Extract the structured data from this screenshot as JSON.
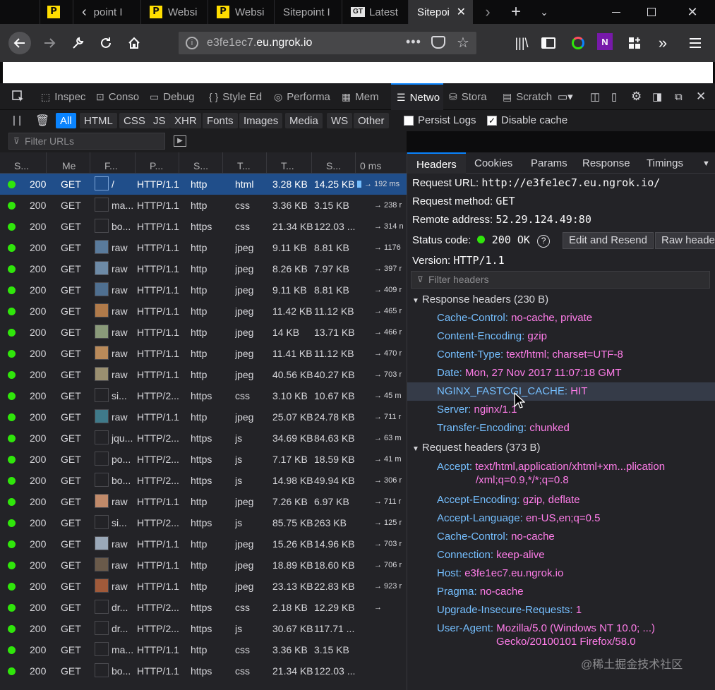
{
  "tabs": [
    {
      "label": "",
      "icon": "sitepoint-logo"
    },
    {
      "label": "point I",
      "icon": "sitepoint-logo"
    },
    {
      "label": "Websi",
      "icon": "sitepoint-logo"
    },
    {
      "label": "Websi",
      "icon": "sitepoint-logo"
    },
    {
      "label": "Sitepoint I",
      "icon": ""
    },
    {
      "label": "Latest",
      "icon": "gt-logo"
    },
    {
      "label": "Sitepoi",
      "icon": ""
    }
  ],
  "nav": {
    "url_host_prefix": "e3fe1ec7.",
    "url_host_main": "eu.ngrok.io"
  },
  "devtools": {
    "tabs": [
      {
        "label": "Inspec"
      },
      {
        "label": "Conso"
      },
      {
        "label": "Debug"
      },
      {
        "label": "Style Ed"
      },
      {
        "label": "Performa"
      },
      {
        "label": "Mem"
      },
      {
        "label": "Netwo"
      },
      {
        "label": "Stora"
      },
      {
        "label": "Scratch"
      }
    ]
  },
  "filters": {
    "types": [
      "All",
      "HTML",
      "CSS",
      "JS",
      "XHR",
      "Fonts",
      "Images",
      "Media",
      "WS",
      "Other"
    ],
    "persist_logs": "Persist Logs",
    "disable_cache": "Disable cache",
    "url_placeholder": "Filter URLs"
  },
  "columns": [
    "S...",
    "Me",
    "F...",
    "P...",
    "S...",
    "T...",
    "T...",
    "S...",
    "0 ms"
  ],
  "requests": [
    {
      "status": "200",
      "method": "GET",
      "file": "/",
      "proto": "HTTP/1.1",
      "scheme": "http",
      "type": "html",
      "transferred": "3.28 KB",
      "size": "14.25 KB",
      "time": "→ 192 ms",
      "thumb": "",
      "sel": true
    },
    {
      "status": "200",
      "method": "GET",
      "file": "ma...",
      "proto": "HTTP/1.1",
      "scheme": "http",
      "type": "css",
      "transferred": "3.36 KB",
      "size": "3.15 KB",
      "time": "→ 238 r",
      "thumb": ""
    },
    {
      "status": "200",
      "method": "GET",
      "file": "bo...",
      "proto": "HTTP/1.1",
      "scheme": "https",
      "type": "css",
      "transferred": "21.34 KB",
      "size": "122.03 ...",
      "time": "→ 314 n",
      "thumb": ""
    },
    {
      "status": "200",
      "method": "GET",
      "file": "raw",
      "proto": "HTTP/1.1",
      "scheme": "http",
      "type": "jpeg",
      "transferred": "9.11 KB",
      "size": "8.81 KB",
      "time": "→ 1176",
      "thumb": "#5a7b9c"
    },
    {
      "status": "200",
      "method": "GET",
      "file": "raw",
      "proto": "HTTP/1.1",
      "scheme": "http",
      "type": "jpeg",
      "transferred": "8.26 KB",
      "size": "7.97 KB",
      "time": "→ 397 r",
      "thumb": "#6d8aa6"
    },
    {
      "status": "200",
      "method": "GET",
      "file": "raw",
      "proto": "HTTP/1.1",
      "scheme": "http",
      "type": "jpeg",
      "transferred": "9.11 KB",
      "size": "8.81 KB",
      "time": "→ 409 r",
      "thumb": "#4f6f90"
    },
    {
      "status": "200",
      "method": "GET",
      "file": "raw",
      "proto": "HTTP/1.1",
      "scheme": "http",
      "type": "jpeg",
      "transferred": "11.42 KB",
      "size": "11.12 KB",
      "time": "→ 465 r",
      "thumb": "#b07a4a"
    },
    {
      "status": "200",
      "method": "GET",
      "file": "raw",
      "proto": "HTTP/1.1",
      "scheme": "http",
      "type": "jpeg",
      "transferred": "14 KB",
      "size": "13.71 KB",
      "time": "→ 466 r",
      "thumb": "#8a9a7a"
    },
    {
      "status": "200",
      "method": "GET",
      "file": "raw",
      "proto": "HTTP/1.1",
      "scheme": "http",
      "type": "jpeg",
      "transferred": "11.41 KB",
      "size": "11.12 KB",
      "time": "→ 470 r",
      "thumb": "#b98a5a"
    },
    {
      "status": "200",
      "method": "GET",
      "file": "raw",
      "proto": "HTTP/1.1",
      "scheme": "http",
      "type": "jpeg",
      "transferred": "40.56 KB",
      "size": "40.27 KB",
      "time": "→ 703 r",
      "thumb": "#9a8f70"
    },
    {
      "status": "200",
      "method": "GET",
      "file": "si...",
      "proto": "HTTP/2...",
      "scheme": "https",
      "type": "css",
      "transferred": "3.10 KB",
      "size": "10.67 KB",
      "time": "→ 45 m",
      "thumb": ""
    },
    {
      "status": "200",
      "method": "GET",
      "file": "raw",
      "proto": "HTTP/1.1",
      "scheme": "http",
      "type": "jpeg",
      "transferred": "25.07 KB",
      "size": "24.78 KB",
      "time": "→ 711 r",
      "thumb": "#3f7a8a"
    },
    {
      "status": "200",
      "method": "GET",
      "file": "jqu...",
      "proto": "HTTP/2...",
      "scheme": "https",
      "type": "js",
      "transferred": "34.69 KB",
      "size": "84.63 KB",
      "time": "→ 63 m",
      "thumb": ""
    },
    {
      "status": "200",
      "method": "GET",
      "file": "po...",
      "proto": "HTTP/2...",
      "scheme": "https",
      "type": "js",
      "transferred": "7.17 KB",
      "size": "18.59 KB",
      "time": "→ 41 m",
      "thumb": ""
    },
    {
      "status": "200",
      "method": "GET",
      "file": "bo...",
      "proto": "HTTP/2...",
      "scheme": "https",
      "type": "js",
      "transferred": "14.98 KB",
      "size": "49.94 KB",
      "time": "→ 306 r",
      "thumb": ""
    },
    {
      "status": "200",
      "method": "GET",
      "file": "raw",
      "proto": "HTTP/1.1",
      "scheme": "http",
      "type": "jpeg",
      "transferred": "7.26 KB",
      "size": "6.97 KB",
      "time": "→ 711 r",
      "thumb": "#c08a6a"
    },
    {
      "status": "200",
      "method": "GET",
      "file": "si...",
      "proto": "HTTP/2...",
      "scheme": "https",
      "type": "js",
      "transferred": "85.75 KB",
      "size": "263 KB",
      "time": "→ 125 r",
      "thumb": ""
    },
    {
      "status": "200",
      "method": "GET",
      "file": "raw",
      "proto": "HTTP/1.1",
      "scheme": "http",
      "type": "jpeg",
      "transferred": "15.26 KB",
      "size": "14.96 KB",
      "time": "→ 703 r",
      "thumb": "#9aa8b8"
    },
    {
      "status": "200",
      "method": "GET",
      "file": "raw",
      "proto": "HTTP/1.1",
      "scheme": "http",
      "type": "jpeg",
      "transferred": "18.89 KB",
      "size": "18.60 KB",
      "time": "→ 706 r",
      "thumb": "#6a5a4a"
    },
    {
      "status": "200",
      "method": "GET",
      "file": "raw",
      "proto": "HTTP/1.1",
      "scheme": "http",
      "type": "jpeg",
      "transferred": "23.13 KB",
      "size": "22.83 KB",
      "time": "→ 923 r",
      "thumb": "#a05a3a"
    },
    {
      "status": "200",
      "method": "GET",
      "file": "dr...",
      "proto": "HTTP/2...",
      "scheme": "https",
      "type": "css",
      "transferred": "2.18 KB",
      "size": "12.29 KB",
      "time": "→",
      "thumb": ""
    },
    {
      "status": "200",
      "method": "GET",
      "file": "dr...",
      "proto": "HTTP/2...",
      "scheme": "https",
      "type": "js",
      "transferred": "30.67 KB",
      "size": "117.71 ...",
      "time": "",
      "thumb": ""
    },
    {
      "status": "200",
      "method": "GET",
      "file": "ma...",
      "proto": "HTTP/1.1",
      "scheme": "http",
      "type": "css",
      "transferred": "3.36 KB",
      "size": "3.15 KB",
      "time": "",
      "thumb": ""
    },
    {
      "status": "200",
      "method": "GET",
      "file": "bo...",
      "proto": "HTTP/1.1",
      "scheme": "https",
      "type": "css",
      "transferred": "21.34 KB",
      "size": "122.03 ...",
      "time": "",
      "thumb": ""
    }
  ],
  "details": {
    "tabs": [
      "Headers",
      "Cookies",
      "Params",
      "Response",
      "Timings"
    ],
    "request_url_label": "Request URL:",
    "request_url": "http://e3fe1ec7.eu.ngrok.io/",
    "request_method_label": "Request method:",
    "request_method": "GET",
    "remote_address_label": "Remote address:",
    "remote_address": "52.29.124.49:80",
    "status_code_label": "Status code:",
    "status_code": "200 OK",
    "edit_resend": "Edit and Resend",
    "raw_headers": "Raw header",
    "version_label": "Version:",
    "version": "HTTP/1.1",
    "filter_placeholder": "Filter headers",
    "response_section": "Response headers (230 B)",
    "request_section": "Request headers (373 B)",
    "response_headers": [
      {
        "name": "Cache-Control:",
        "value": "no-cache, private"
      },
      {
        "name": "Content-Encoding:",
        "value": "gzip"
      },
      {
        "name": "Content-Type:",
        "value": "text/html; charset=UTF-8"
      },
      {
        "name": "Date:",
        "value": "Mon, 27 Nov 2017 11:07:18 GMT"
      },
      {
        "name": "NGINX_FASTCGI_CACHE:",
        "value": "HIT"
      },
      {
        "name": "Server:",
        "value": "nginx/1.1"
      },
      {
        "name": "Transfer-Encoding:",
        "value": "chunked"
      }
    ],
    "request_headers": [
      {
        "name": "Accept:",
        "value": "text/html,application/xhtml+xm...plication",
        "value2": "/xml;q=0.9,*/*;q=0.8"
      },
      {
        "name": "Accept-Encoding:",
        "value": "gzip, deflate"
      },
      {
        "name": "Accept-Language:",
        "value": "en-US,en;q=0.5"
      },
      {
        "name": "Cache-Control:",
        "value": "no-cache"
      },
      {
        "name": "Connection:",
        "value": "keep-alive"
      },
      {
        "name": "Host:",
        "value": "e3fe1ec7.eu.ngrok.io"
      },
      {
        "name": "Pragma:",
        "value": "no-cache"
      },
      {
        "name": "Upgrade-Insecure-Requests:",
        "value": "1"
      },
      {
        "name": "User-Agent:",
        "value": "Mozilla/5.0 (Windows NT 10.0; ...)",
        "value2": "Gecko/20100101 Firefox/58.0"
      }
    ]
  },
  "watermark": "@稀土掘金技术社区"
}
